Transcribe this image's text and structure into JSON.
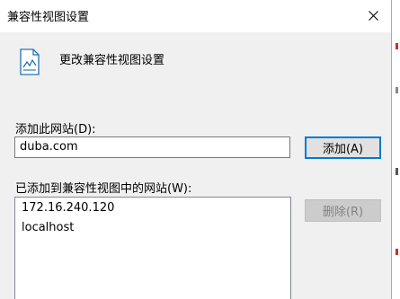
{
  "dialog": {
    "title": "兼容性视图设置",
    "heading": "更改兼容性视图设置"
  },
  "add_site": {
    "label": "添加此网站(D):",
    "value": "duba.com",
    "button_label": "添加(A)"
  },
  "site_list": {
    "label": "已添加到兼容性视图中的网站(W):",
    "items": [
      "172.16.240.120",
      "localhost"
    ],
    "remove_label": "删除(R)"
  },
  "icons": {
    "close": "close-icon",
    "header": "compatibility-view-icon"
  },
  "colors": {
    "accent": "#0078d7",
    "client_bg": "#f0f0f0"
  }
}
